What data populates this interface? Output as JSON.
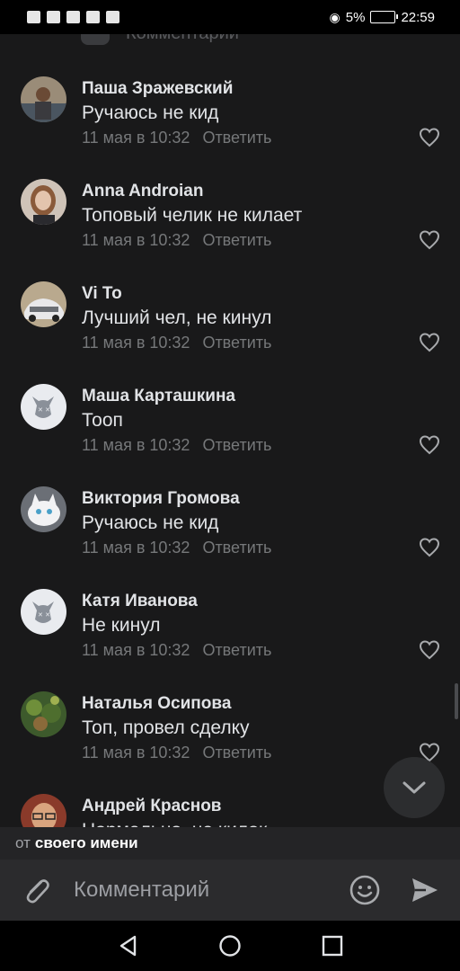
{
  "status_bar": {
    "battery_percent": "5%",
    "time": "22:59"
  },
  "list": {
    "top_partial_placeholder": "Комментарий"
  },
  "comments": [
    {
      "name": "Паша Зражевский",
      "text": "Ручаюсь не кид",
      "time": "11 мая в 10:32",
      "reply": "Ответить",
      "avatar": "photo-man"
    },
    {
      "name": "Anna Androian",
      "text": "Топовый челик не килает",
      "time": "11 мая в 10:32",
      "reply": "Ответить",
      "avatar": "photo-woman"
    },
    {
      "name": "Vi To",
      "text": "Лучший чел, не кинул",
      "time": "11 мая в 10:32",
      "reply": "Ответить",
      "avatar": "photo-car"
    },
    {
      "name": "Маша Карташкина",
      "text": "Тооп",
      "time": "11 мая в 10:32",
      "reply": "Ответить",
      "avatar": "dog-default"
    },
    {
      "name": "Виктория Громова",
      "text": "Ручаюсь не кид",
      "time": "11 мая в 10:32",
      "reply": "Ответить",
      "avatar": "photo-cat"
    },
    {
      "name": "Катя Иванова",
      "text": "Не кинул",
      "time": "11 мая в 10:32",
      "reply": "Ответить",
      "avatar": "dog-default"
    },
    {
      "name": "Наталья Осипова",
      "text": "Топ, провел сделку",
      "time": "11 мая в 10:32",
      "reply": "Ответить",
      "avatar": "photo-plants"
    },
    {
      "name": "Андрей Краснов",
      "text": "Нормально, не килок",
      "time": "",
      "reply": "",
      "avatar": "photo-man-glasses"
    }
  ],
  "author_bar": {
    "prefix": "от",
    "identity": "своего имени"
  },
  "composer": {
    "placeholder": "Комментарий"
  },
  "icons": {
    "like": "heart-outline-icon",
    "scroll_down": "chevron-down-icon",
    "attach": "paperclip-icon",
    "emoji": "smile-icon",
    "send": "send-icon",
    "nav_back": "triangle-back-icon",
    "nav_home": "circle-home-icon",
    "nav_recent": "square-recent-icon"
  },
  "colors": {
    "background": "#19191a",
    "secondary_text": "#76787a",
    "composer_bg": "#2b2b2d"
  }
}
